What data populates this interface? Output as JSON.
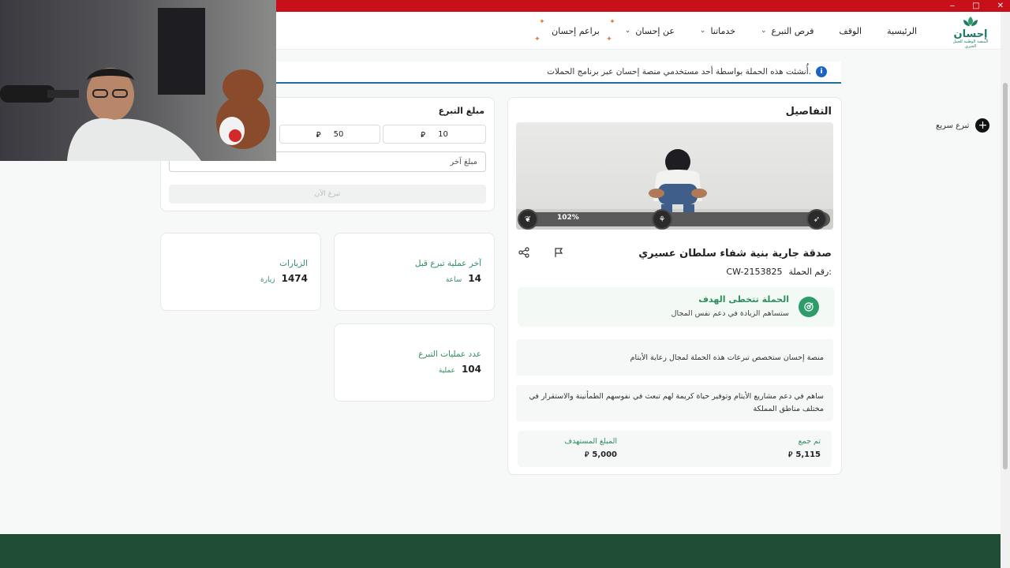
{
  "window": {
    "controls": [
      "‒",
      "□",
      "✕"
    ]
  },
  "nav": {
    "logo_text": "إحسان",
    "logo_sub": "المنصة الوطنية للعمل الخيري",
    "links": [
      {
        "label": "الرئيسية",
        "dropdown": false
      },
      {
        "label": "الوقف",
        "dropdown": false
      },
      {
        "label": "فرص التبرع",
        "dropdown": true
      },
      {
        "label": "خدماتنا",
        "dropdown": true
      },
      {
        "label": "عن إحسان",
        "dropdown": true
      },
      {
        "label": "براعم إحسان",
        "dropdown": false
      }
    ]
  },
  "notice": {
    "text": "أُنشئت هذه الحملة بواسطة أحد مستخدمي منصة إحسان عبر برنامج الحملات."
  },
  "quick_donate": {
    "label": "تبرع سريع"
  },
  "details": {
    "title": "التفاصيل",
    "progress_percent": "102%",
    "progress_fraction": 1.0,
    "campaign_title": "صدقة جارية بنية شفاء سلطان عسيري",
    "campaign_no_label": "رقم الحملة:",
    "campaign_no": "CW-2153825",
    "goal_title": "الحملة تتخطى الهدف",
    "goal_sub": "ستساهم الزيادة في دعم نفس المجال",
    "note1": "منصة إحسان ستخصص تبرعات هذه الحملة لمجال رعاية الأيتام",
    "note2": "ساهم في دعم مشاريع الأيتام وتوفير حياة كريمة لهم تبعث في نفوسهم الطمأنينة والاستقرار في مختلف مناطق المملكة",
    "collected_label": "تم جمع",
    "collected_value": "5,115",
    "target_label": "المبلغ المستهدف",
    "target_value": "5,000",
    "currency": "⃁"
  },
  "donation": {
    "title": "مبلغ التبرع",
    "amounts": [
      "10",
      "50"
    ],
    "other_placeholder": "مبلغ آخر",
    "donate_button": "تبرع الآن"
  },
  "stats": {
    "visits_label": "الزيارات",
    "visits_value": "1474",
    "visits_unit": "زيارة",
    "last_label": "آخر عملية تبرع قبل",
    "last_value": "14",
    "last_unit": "ساعة",
    "count_label": "عدد عمليات التبرع",
    "count_value": "104",
    "count_unit": "عملية"
  },
  "colors": {
    "accent": "#2e8f5f",
    "topbar": "#c8101a",
    "footer": "#1f4d34",
    "info": "#1e63c2"
  }
}
